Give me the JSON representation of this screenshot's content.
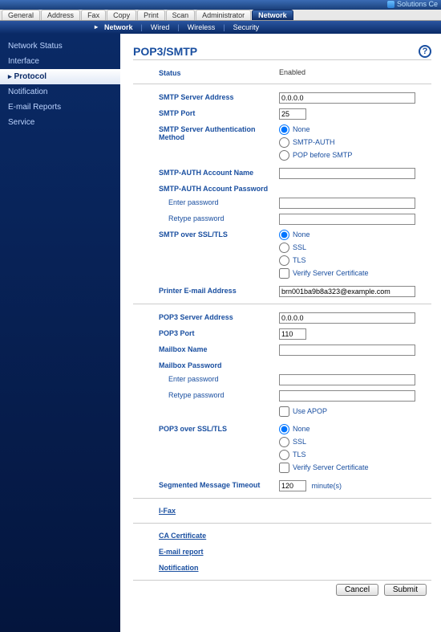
{
  "top_link": "Solutions Ce",
  "tabs": [
    "General",
    "Address",
    "Fax",
    "Copy",
    "Print",
    "Scan",
    "Administrator",
    "Network"
  ],
  "subnav": [
    "Network",
    "Wired",
    "Wireless",
    "Security"
  ],
  "sidebar": [
    "Network Status",
    "Interface",
    "Protocol",
    "Notification",
    "E-mail Reports",
    "Service"
  ],
  "title": "POP3/SMTP",
  "status": {
    "label": "Status",
    "value": "Enabled"
  },
  "smtp": {
    "server_label": "SMTP Server Address",
    "server_value": "0.0.0.0",
    "port_label": "SMTP Port",
    "port_value": "25",
    "auth_label": "SMTP Server Authentication Method",
    "auth_opts": [
      "None",
      "SMTP-AUTH",
      "POP before SMTP"
    ],
    "acct_name_label": "SMTP-AUTH Account Name",
    "acct_name_value": "",
    "acct_pw_label": "SMTP-AUTH Account Password",
    "enter_pw": "Enter password",
    "retype_pw": "Retype password",
    "ssl_label": "SMTP over SSL/TLS",
    "ssl_opts": [
      "None",
      "SSL",
      "TLS"
    ],
    "verify_cert": "Verify Server Certificate",
    "printer_email_label": "Printer E-mail Address",
    "printer_email_value": "brn001ba9b8a323@example.com"
  },
  "pop3": {
    "server_label": "POP3 Server Address",
    "server_value": "0.0.0.0",
    "port_label": "POP3 Port",
    "port_value": "110",
    "mailbox_label": "Mailbox Name",
    "mailbox_value": "",
    "mailbox_pw_label": "Mailbox Password",
    "enter_pw": "Enter password",
    "retype_pw": "Retype password",
    "apop": "Use APOP",
    "ssl_label": "POP3 over SSL/TLS",
    "ssl_opts": [
      "None",
      "SSL",
      "TLS"
    ],
    "verify_cert": "Verify Server Certificate",
    "timeout_label": "Segmented Message Timeout",
    "timeout_value": "120",
    "timeout_unit": "minute(s)"
  },
  "links": [
    "I-Fax",
    "CA Certificate",
    "E-mail report",
    "Notification"
  ],
  "buttons": {
    "cancel": "Cancel",
    "submit": "Submit"
  }
}
